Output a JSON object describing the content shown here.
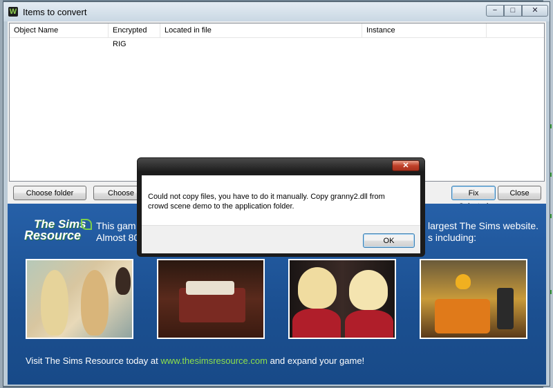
{
  "window": {
    "title": "Items to convert",
    "icon": "W",
    "min": "−",
    "max": "□",
    "close": "✕"
  },
  "list": {
    "columns": [
      "Object Name",
      "Encrypted RIG",
      "Located in file",
      "Instance"
    ],
    "rows": []
  },
  "buttons": {
    "choose_folder": "Choose folder",
    "choose": "Choose",
    "fix_selected": "Fix Selected",
    "close": "Close"
  },
  "banner": {
    "logo_line1": "The Sims",
    "logo_line2": "Resource",
    "promo_left_1": "This gam",
    "promo_left_2": "Almost 80",
    "promo_right_1": "largest The Sims website.",
    "promo_right_2": "s including:",
    "visit_prefix": "Visit The Sims Resource today at",
    "visit_link": "www.thesimsresource.com",
    "visit_suffix": "and expand your game!"
  },
  "dialog": {
    "message": "Could not copy files, you have to do it manually. Copy granny2.dll from crowd scene demo to the application folder.",
    "ok": "OK",
    "close": "✕"
  },
  "colors": {
    "banner": "#1d5396",
    "link": "#8ee04a",
    "dialog_close": "#c0412a"
  }
}
